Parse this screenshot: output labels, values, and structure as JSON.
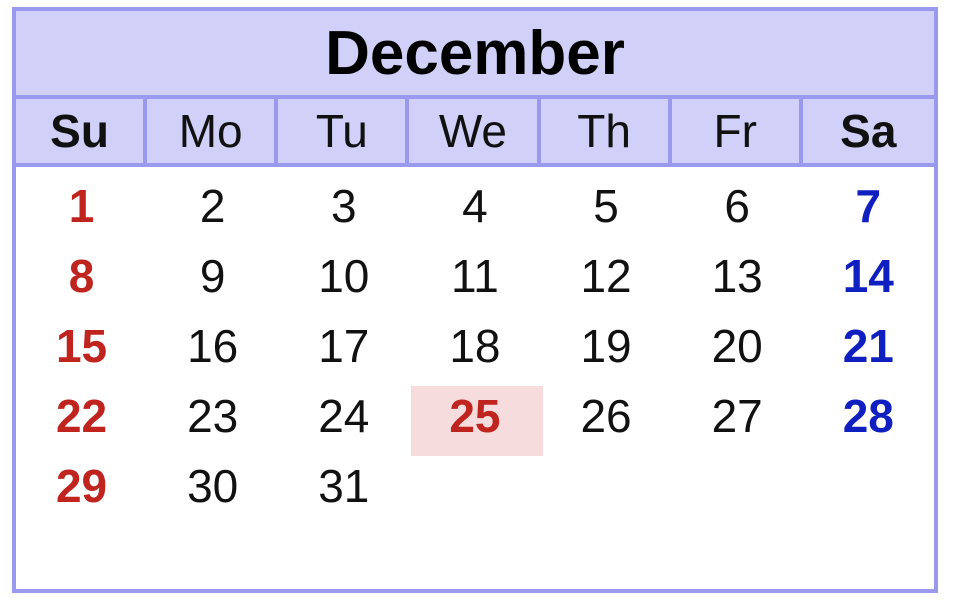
{
  "calendar": {
    "month": "December",
    "weekdays": [
      "Su",
      "Mo",
      "Tu",
      "We",
      "Th",
      "Fr",
      "Sa"
    ],
    "weeks": [
      [
        "1",
        "2",
        "3",
        "4",
        "5",
        "6",
        "7"
      ],
      [
        "8",
        "9",
        "10",
        "11",
        "12",
        "13",
        "14"
      ],
      [
        "15",
        "16",
        "17",
        "18",
        "19",
        "20",
        "21"
      ],
      [
        "22",
        "23",
        "24",
        "25",
        "26",
        "27",
        "28"
      ],
      [
        "29",
        "30",
        "31",
        "",
        "",
        "",
        ""
      ]
    ],
    "highlighted_day": "25",
    "colors": {
      "border": "#9999ee",
      "header_bg": "#d0d0f8",
      "sunday": "#c0241f",
      "saturday": "#1020c0",
      "holiday_bg": "#f6dcdc",
      "holiday_text": "#c0241f"
    }
  }
}
